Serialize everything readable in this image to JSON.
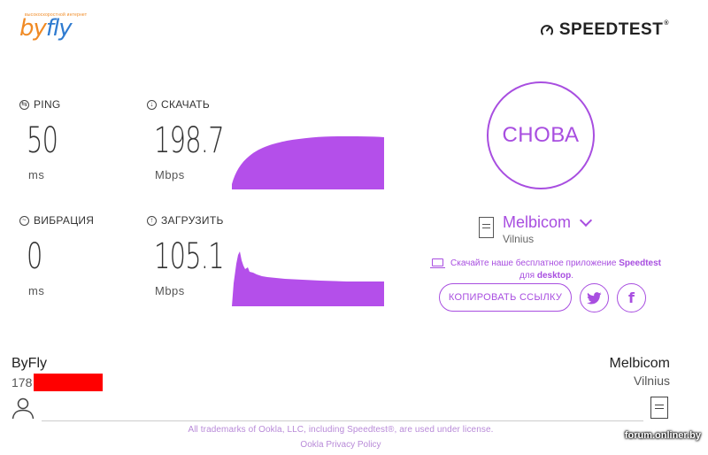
{
  "header": {
    "logo_small": "высокоскоростной интернет",
    "logo_by": "by",
    "logo_fly": "fly",
    "brand": "SPEEDTEST",
    "brand_tm": "®"
  },
  "metrics": {
    "ping": {
      "label": "PING",
      "value": "50",
      "unit": "ms"
    },
    "jitter": {
      "label": "ВИБРАЦИЯ",
      "value": "0",
      "unit": "ms"
    },
    "download": {
      "label": "СКАЧАТЬ",
      "value": "198.7",
      "unit": "Mbps"
    },
    "upload": {
      "label": "ЗАГРУЗИТЬ",
      "value": "105.1",
      "unit": "Mbps"
    }
  },
  "colors": {
    "accent": "#a84ee0",
    "graph": "#b44fea",
    "redact": "#ff0000"
  },
  "again_button": "СНОВА",
  "server": {
    "name": "Melbicom",
    "location": "Vilnius"
  },
  "promo": {
    "text_before": "Скачайте наше бесплатное приложение ",
    "app": "Speedtest",
    "text_mid": "для ",
    "platform": "desktop",
    "text_end": "."
  },
  "copy_link": "КОПИРОВАТЬ ССЫЛКУ",
  "footer": {
    "isp_name": "ByFly",
    "isp_ip_prefix": "178",
    "server_name": "Melbicom",
    "server_location": "Vilnius",
    "legal": "All trademarks of Ookla, LLC, including Speedtest®, are used under license.",
    "privacy": "Ookla Privacy Policy",
    "watermark": "forum.onliner.by"
  }
}
